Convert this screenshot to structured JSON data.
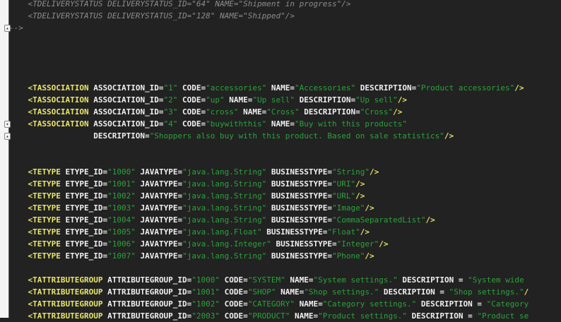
{
  "editor": {
    "lines": [
      [
        [
          "c",
          "    <TDELIVERYSTATUS DELIVERYSTATUS_ID=\"64\" NAME=\"Shipment in progress\"/>"
        ]
      ],
      [
        [
          "c",
          "    <TDELIVERYSTATUS DELIVERYSTATUS_ID=\"128\" NAME=\"Shipped\"/>"
        ]
      ],
      [
        [
          "c",
          "-->"
        ]
      ],
      [],
      [],
      [],
      [],
      [
        [
          "p",
          "    "
        ],
        [
          "t",
          "<TASSOCIATION"
        ],
        [
          "a",
          " ASSOCIATION_ID="
        ],
        [
          "v",
          "\"1\""
        ],
        [
          "a",
          " CODE="
        ],
        [
          "v",
          "\"accessories\""
        ],
        [
          "a",
          " NAME="
        ],
        [
          "v",
          "\"Accessories\""
        ],
        [
          "a",
          " DESCRIPTION="
        ],
        [
          "v",
          "\"Product accessories\""
        ],
        [
          "t",
          "/>"
        ]
      ],
      [
        [
          "p",
          "    "
        ],
        [
          "t",
          "<TASSOCIATION"
        ],
        [
          "a",
          " ASSOCIATION_ID="
        ],
        [
          "v",
          "\"2\""
        ],
        [
          "a",
          " CODE="
        ],
        [
          "v",
          "\"up\""
        ],
        [
          "a",
          " NAME="
        ],
        [
          "v",
          "\"Up sell\""
        ],
        [
          "a",
          " DESCRIPTION="
        ],
        [
          "v",
          "\"Up sell\""
        ],
        [
          "t",
          "/>"
        ]
      ],
      [
        [
          "p",
          "    "
        ],
        [
          "t",
          "<TASSOCIATION"
        ],
        [
          "a",
          " ASSOCIATION_ID="
        ],
        [
          "v",
          "\"3\""
        ],
        [
          "a",
          " CODE="
        ],
        [
          "v",
          "\"cross\""
        ],
        [
          "a",
          " NAME="
        ],
        [
          "v",
          "\"Cross\""
        ],
        [
          "a",
          " DESCRIPTION="
        ],
        [
          "v",
          "\"Cross\""
        ],
        [
          "t",
          "/>"
        ]
      ],
      [
        [
          "p",
          "    "
        ],
        [
          "t",
          "<TASSOCIATION"
        ],
        [
          "a",
          " ASSOCIATION_ID="
        ],
        [
          "v",
          "\"4\""
        ],
        [
          "a",
          " CODE="
        ],
        [
          "v",
          "\"buywiththis\""
        ],
        [
          "a",
          " NAME="
        ],
        [
          "v",
          "\"Buy with this products\""
        ]
      ],
      [
        [
          "a",
          "                  DESCRIPTION="
        ],
        [
          "v",
          "\"Shoppers also buy with this product. Based on sale statistics\""
        ],
        [
          "t",
          "/>"
        ]
      ],
      [],
      [],
      [
        [
          "p",
          "    "
        ],
        [
          "t",
          "<TETYPE"
        ],
        [
          "a",
          " ETYPE_ID="
        ],
        [
          "v",
          "\"1000\""
        ],
        [
          "a",
          " JAVATYPE="
        ],
        [
          "v",
          "\"java.lang.String\""
        ],
        [
          "a",
          " BUSINESSTYPE="
        ],
        [
          "v",
          "\"String\""
        ],
        [
          "t",
          "/>"
        ]
      ],
      [
        [
          "p",
          "    "
        ],
        [
          "t",
          "<TETYPE"
        ],
        [
          "a",
          " ETYPE_ID="
        ],
        [
          "v",
          "\"1001\""
        ],
        [
          "a",
          " JAVATYPE="
        ],
        [
          "v",
          "\"java.lang.String\""
        ],
        [
          "a",
          " BUSINESSTYPE="
        ],
        [
          "v",
          "\"URI\""
        ],
        [
          "t",
          "/>"
        ]
      ],
      [
        [
          "p",
          "    "
        ],
        [
          "t",
          "<TETYPE"
        ],
        [
          "a",
          " ETYPE_ID="
        ],
        [
          "v",
          "\"1002\""
        ],
        [
          "a",
          " JAVATYPE="
        ],
        [
          "v",
          "\"java.lang.String\""
        ],
        [
          "a",
          " BUSINESSTYPE="
        ],
        [
          "v",
          "\"URL\""
        ],
        [
          "t",
          "/>"
        ]
      ],
      [
        [
          "p",
          "    "
        ],
        [
          "t",
          "<TETYPE"
        ],
        [
          "a",
          " ETYPE_ID="
        ],
        [
          "v",
          "\"1003\""
        ],
        [
          "a",
          " JAVATYPE="
        ],
        [
          "v",
          "\"java.lang.String\""
        ],
        [
          "a",
          " BUSINESSTYPE="
        ],
        [
          "v",
          "\"Image\""
        ],
        [
          "t",
          "/>"
        ]
      ],
      [
        [
          "p",
          "    "
        ],
        [
          "t",
          "<TETYPE"
        ],
        [
          "a",
          " ETYPE_ID="
        ],
        [
          "v",
          "\"1004\""
        ],
        [
          "a",
          " JAVATYPE="
        ],
        [
          "v",
          "\"java.lang.String\""
        ],
        [
          "a",
          " BUSINESSTYPE="
        ],
        [
          "v",
          "\"CommaSeparatedList\""
        ],
        [
          "t",
          "/>"
        ]
      ],
      [
        [
          "p",
          "    "
        ],
        [
          "t",
          "<TETYPE"
        ],
        [
          "a",
          " ETYPE_ID="
        ],
        [
          "v",
          "\"1005\""
        ],
        [
          "a",
          " JAVATYPE="
        ],
        [
          "v",
          "\"java.lang.Float\""
        ],
        [
          "a",
          " BUSINESSTYPE="
        ],
        [
          "v",
          "\"Float\""
        ],
        [
          "t",
          "/>"
        ]
      ],
      [
        [
          "p",
          "    "
        ],
        [
          "t",
          "<TETYPE"
        ],
        [
          "a",
          " ETYPE_ID="
        ],
        [
          "v",
          "\"1006\""
        ],
        [
          "a",
          " JAVATYPE="
        ],
        [
          "v",
          "\"java.lang.Integer\""
        ],
        [
          "a",
          " BUSINESSTYPE="
        ],
        [
          "v",
          "\"Integer\""
        ],
        [
          "t",
          "/>"
        ]
      ],
      [
        [
          "p",
          "    "
        ],
        [
          "t",
          "<TETYPE"
        ],
        [
          "a",
          " ETYPE_ID="
        ],
        [
          "v",
          "\"1007\""
        ],
        [
          "a",
          " JAVATYPE="
        ],
        [
          "v",
          "\"java.lang.String\""
        ],
        [
          "a",
          " BUSINESSTYPE="
        ],
        [
          "v",
          "\"Phone\""
        ],
        [
          "t",
          "/>"
        ]
      ],
      [],
      [
        [
          "p",
          "    "
        ],
        [
          "t",
          "<TATTRIBUTEGROUP"
        ],
        [
          "a",
          " ATTRIBUTEGROUP_ID="
        ],
        [
          "v",
          "\"1000\""
        ],
        [
          "a",
          " CODE="
        ],
        [
          "v",
          "\"SYSTEM\""
        ],
        [
          "a",
          " NAME="
        ],
        [
          "v",
          "\"System settings.\""
        ],
        [
          "a",
          " DESCRIPTION = "
        ],
        [
          "v",
          "\"System wide"
        ]
      ],
      [
        [
          "p",
          "    "
        ],
        [
          "t",
          "<TATTRIBUTEGROUP"
        ],
        [
          "a",
          " ATTRIBUTEGROUP_ID="
        ],
        [
          "v",
          "\"1001\""
        ],
        [
          "a",
          " CODE="
        ],
        [
          "v",
          "\"SHOP\""
        ],
        [
          "a",
          " NAME="
        ],
        [
          "v",
          "\"Shop settings.\""
        ],
        [
          "a",
          " DESCRIPTION = "
        ],
        [
          "v",
          "\"Shop settings.\""
        ],
        [
          "t",
          "/"
        ]
      ],
      [
        [
          "p",
          "    "
        ],
        [
          "t",
          "<TATTRIBUTEGROUP"
        ],
        [
          "a",
          " ATTRIBUTEGROUP_ID="
        ],
        [
          "v",
          "\"1002\""
        ],
        [
          "a",
          " CODE="
        ],
        [
          "v",
          "\"CATEGORY\""
        ],
        [
          "a",
          " NAME="
        ],
        [
          "v",
          "\"Category settings.\""
        ],
        [
          "a",
          " DESCRIPTION = "
        ],
        [
          "v",
          "\"Category"
        ]
      ],
      [
        [
          "p",
          "    "
        ],
        [
          "t",
          "<TATTRIBUTEGROUP"
        ],
        [
          "a",
          " ATTRIBUTEGROUP_ID="
        ],
        [
          "v",
          "\"2003\""
        ],
        [
          "a",
          " CODE="
        ],
        [
          "v",
          "\"PRODUCT\""
        ],
        [
          "a",
          " NAME="
        ],
        [
          "v",
          "\"Product settings.\""
        ],
        [
          "a",
          " DESCRIPTION = "
        ],
        [
          "v",
          "\"Product se"
        ]
      ]
    ],
    "fold_markers": [
      {
        "line": 2,
        "icon": "fold-end-icon"
      },
      {
        "line": 10,
        "icon": "fold-start-icon"
      },
      {
        "line": 11,
        "icon": "fold-end-icon"
      }
    ]
  }
}
